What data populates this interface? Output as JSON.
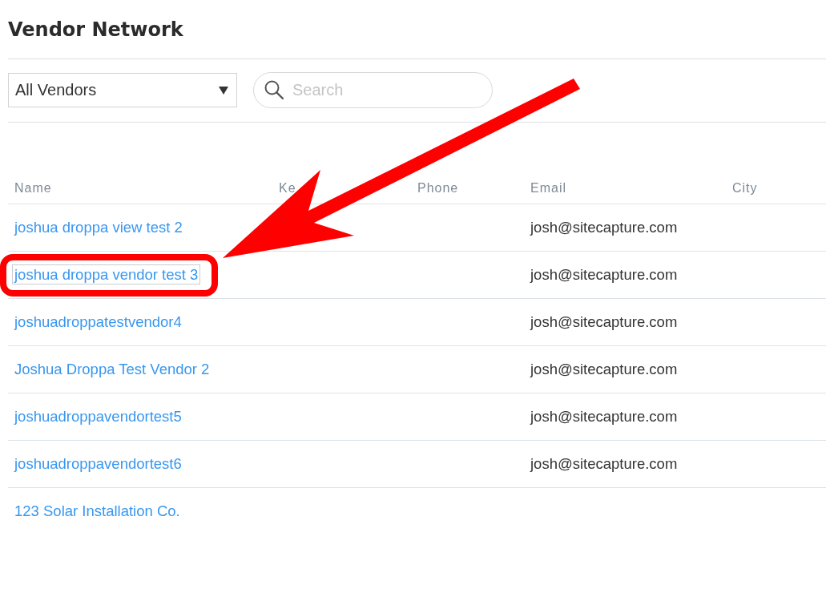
{
  "page": {
    "title": "Vendor Network"
  },
  "filters": {
    "vendor_type": {
      "value": "All Vendors"
    },
    "search": {
      "placeholder": "Search"
    }
  },
  "table": {
    "columns": [
      "Name",
      "Ke",
      "Phone",
      "Email",
      "City"
    ],
    "rows": [
      {
        "name": "joshua droppa view test 2",
        "email": "josh@sitecapture.com",
        "focused": false,
        "highlighted": false
      },
      {
        "name": "joshua droppa vendor test 3",
        "email": "josh@sitecapture.com",
        "focused": true,
        "highlighted": true
      },
      {
        "name": "joshuadroppatestvendor4",
        "email": "josh@sitecapture.com",
        "focused": false,
        "highlighted": false
      },
      {
        "name": "Joshua Droppa Test Vendor 2",
        "email": "josh@sitecapture.com",
        "focused": false,
        "highlighted": false
      },
      {
        "name": "joshuadroppavendortest5",
        "email": "josh@sitecapture.com",
        "focused": false,
        "highlighted": false
      },
      {
        "name": "joshuadroppavendortest6",
        "email": "josh@sitecapture.com",
        "focused": false,
        "highlighted": false
      },
      {
        "name": "123 Solar Installation Co.",
        "focused": false,
        "highlighted": false
      }
    ]
  }
}
